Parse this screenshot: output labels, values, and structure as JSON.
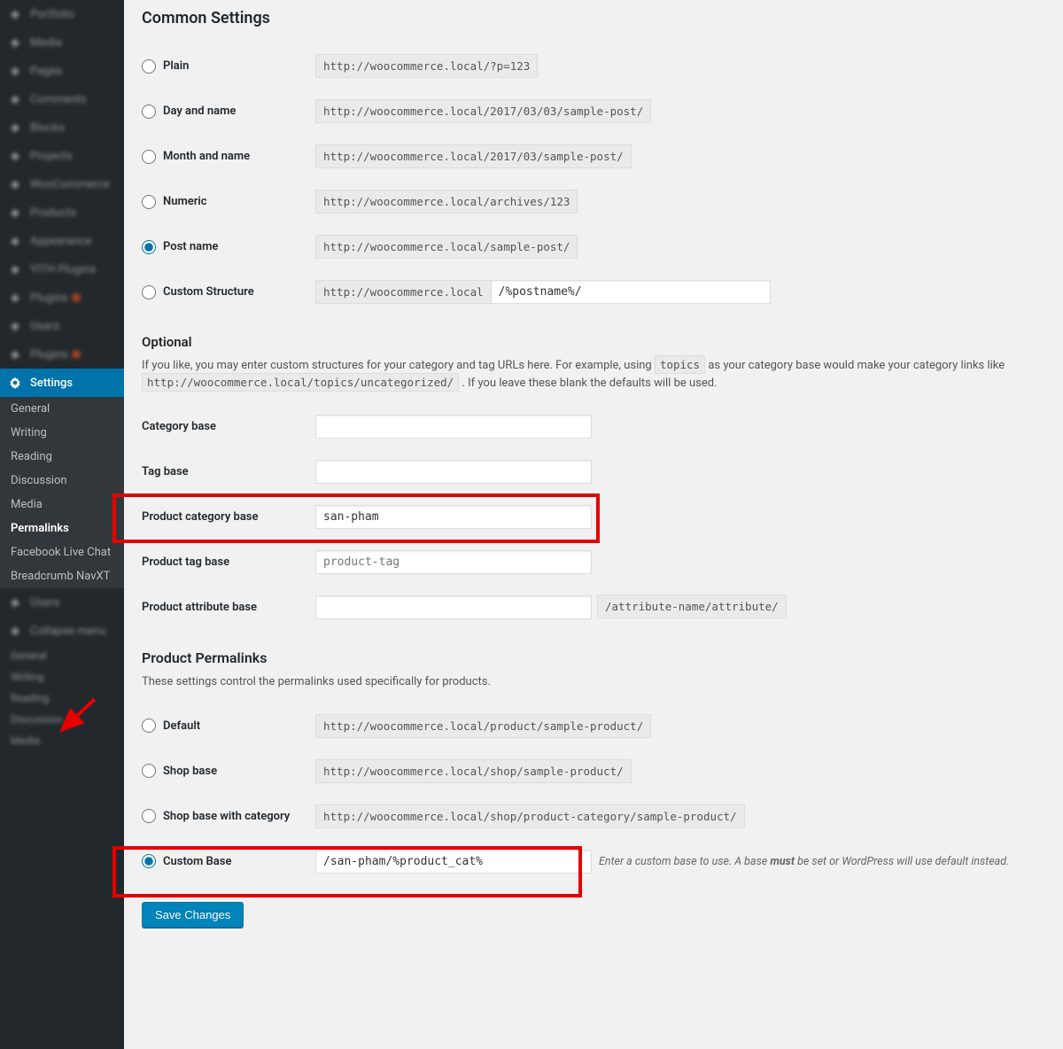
{
  "sidebar": {
    "blurred_top": [
      "Portfolio",
      "Media",
      "Pages",
      "Comments",
      "Blocks",
      "Projects",
      "WooCommerce",
      "Products",
      "Appearance",
      "YITH Plugins",
      "Plugins",
      "Users",
      "Plugins"
    ],
    "settings_label": "Settings",
    "submenu": [
      "General",
      "Writing",
      "Reading",
      "Discussion",
      "Media",
      "Permalinks",
      "Facebook Live Chat",
      "Breadcrumb NavXT"
    ],
    "submenu_current": "Permalinks",
    "blurred_bottom": [
      "Users",
      "Collapse menu",
      "General",
      "Writing",
      "Reading",
      "Discussion",
      "Media"
    ]
  },
  "common": {
    "heading": "Common Settings",
    "rows": [
      {
        "label": "Plain",
        "url": "http://woocommerce.local/?p=123",
        "checked": false
      },
      {
        "label": "Day and name",
        "url": "http://woocommerce.local/2017/03/03/sample-post/",
        "checked": false
      },
      {
        "label": "Month and name",
        "url": "http://woocommerce.local/2017/03/sample-post/",
        "checked": false
      },
      {
        "label": "Numeric",
        "url": "http://woocommerce.local/archives/123",
        "checked": false
      },
      {
        "label": "Post name",
        "url": "http://woocommerce.local/sample-post/",
        "checked": true
      }
    ],
    "custom_label": "Custom Structure",
    "custom_prefix": "http://woocommerce.local",
    "custom_value": "/%postname%/"
  },
  "optional": {
    "heading": "Optional",
    "desc_before": "If you like, you may enter custom structures for your category and tag URLs here. For example, using ",
    "desc_code1": "topics",
    "desc_mid": " as your category base would make your category links like ",
    "desc_code2": "http://woocommerce.local/topics/uncategorized/",
    "desc_after": " . If you leave these blank the defaults will be used.",
    "rows": [
      {
        "label": "Category base",
        "value": "",
        "placeholder": ""
      },
      {
        "label": "Tag base",
        "value": "",
        "placeholder": ""
      },
      {
        "label": "Product category base",
        "value": "san-pham",
        "placeholder": "",
        "highlight": true
      },
      {
        "label": "Product tag base",
        "value": "",
        "placeholder": "product-tag"
      },
      {
        "label": "Product attribute base",
        "value": "",
        "placeholder": "",
        "suffix": "/attribute-name/attribute/"
      }
    ]
  },
  "product": {
    "heading": "Product Permalinks",
    "desc": "These settings control the permalinks used specifically for products.",
    "rows": [
      {
        "label": "Default",
        "url": "http://woocommerce.local/product/sample-product/",
        "checked": false
      },
      {
        "label": "Shop base",
        "url": "http://woocommerce.local/shop/sample-product/",
        "checked": false
      },
      {
        "label": "Shop base with category",
        "url": "http://woocommerce.local/shop/product-category/sample-product/",
        "checked": false
      }
    ],
    "custom_label": "Custom Base",
    "custom_value": "/san-pham/%product_cat%",
    "custom_hint_before": "Enter a custom base to use. A base ",
    "custom_hint_bold": "must",
    "custom_hint_after": " be set or WordPress will use default instead."
  },
  "save_label": "Save Changes"
}
